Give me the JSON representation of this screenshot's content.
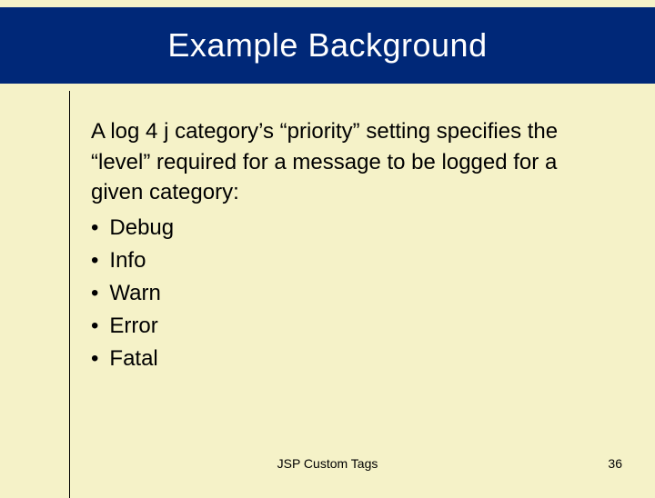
{
  "title": "Example Background",
  "paragraph": "A log 4 j category’s “priority” setting specifies the “level” required for a message to be logged for a given category:",
  "bullets": [
    "Debug",
    "Info",
    "Warn",
    "Error",
    "Fatal"
  ],
  "footer": {
    "center": "JSP Custom Tags",
    "page": "36"
  }
}
